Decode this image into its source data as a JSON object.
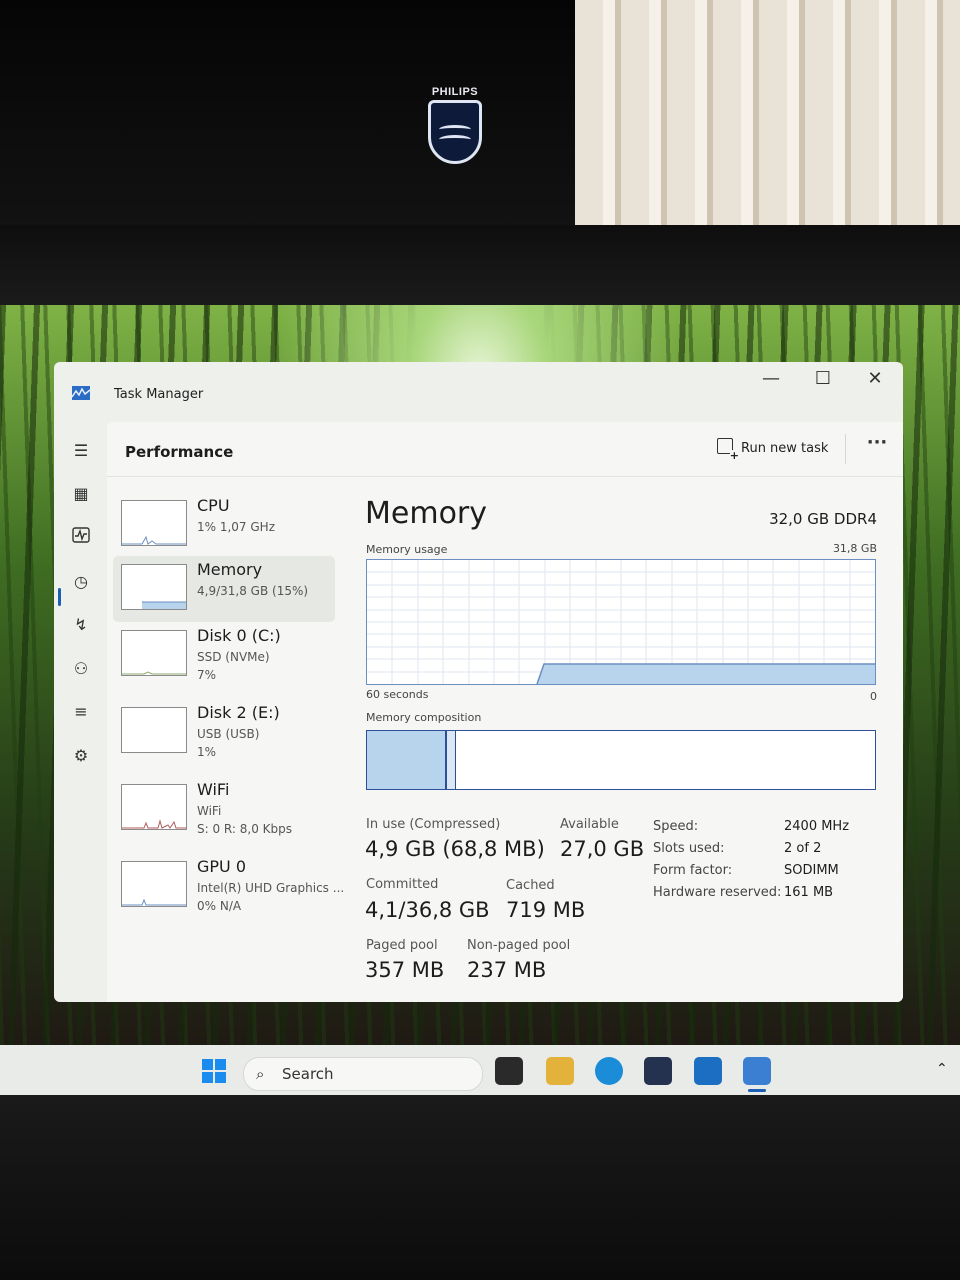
{
  "window": {
    "title": "Task Manager",
    "controls": {
      "minimize": "—",
      "maximize": "☐",
      "close": "✕"
    }
  },
  "toolbar": {
    "section_title": "Performance",
    "run_new_task": "Run new task",
    "more": "···"
  },
  "rail_icons": [
    "hamburger-icon",
    "processes-icon",
    "performance-icon",
    "app-history-icon",
    "startup-apps-icon",
    "users-icon",
    "details-icon",
    "services-icon",
    "settings-icon"
  ],
  "devices": [
    {
      "name": "CPU",
      "line1": "1% 1,07 GHz",
      "line2": ""
    },
    {
      "name": "Memory",
      "line1": "4,9/31,8 GB (15%)",
      "line2": ""
    },
    {
      "name": "Disk 0 (C:)",
      "line1": "SSD (NVMe)",
      "line2": "7%"
    },
    {
      "name": "Disk 2 (E:)",
      "line1": "USB (USB)",
      "line2": "1%"
    },
    {
      "name": "WiFi",
      "line1": "WiFi",
      "line2": "S: 0 R: 8,0 Kbps"
    },
    {
      "name": "GPU 0",
      "line1": "Intel(R) UHD Graphics ...",
      "line2": "0% N/A"
    }
  ],
  "memory": {
    "title": "Memory",
    "spec": "32,0 GB DDR4",
    "usage_label": "Memory usage",
    "usage_max": "31,8 GB",
    "time_label": "60 seconds",
    "zero_label": "0",
    "composition_label": "Memory composition",
    "stats": {
      "in_use_label": "In use (Compressed)",
      "in_use_value": "4,9 GB (68,8 MB)",
      "available_label": "Available",
      "available_value": "27,0 GB",
      "committed_label": "Committed",
      "committed_value": "4,1/36,8 GB",
      "cached_label": "Cached",
      "cached_value": "719 MB",
      "paged_label": "Paged pool",
      "paged_value": "357 MB",
      "nonpaged_label": "Non-paged pool",
      "nonpaged_value": "237 MB"
    },
    "hardware": [
      {
        "key": "Speed:",
        "value": "2400 MHz"
      },
      {
        "key": "Slots used:",
        "value": "2 of 2"
      },
      {
        "key": "Form factor:",
        "value": "SODIMM"
      },
      {
        "key": "Hardware reserved:",
        "value": "161 MB"
      }
    ]
  },
  "taskbar": {
    "search_placeholder": "Search",
    "apps": [
      "task-view-icon",
      "file-explorer-icon",
      "edge-icon",
      "store-icon",
      "outlook-icon",
      "task-manager-icon"
    ]
  },
  "bezel": {
    "brand": "PHILIPS"
  },
  "colors": {
    "accent": "#1b5fb5",
    "graph_fill": "#b8d3ec",
    "graph_border": "#6b8fc2"
  }
}
